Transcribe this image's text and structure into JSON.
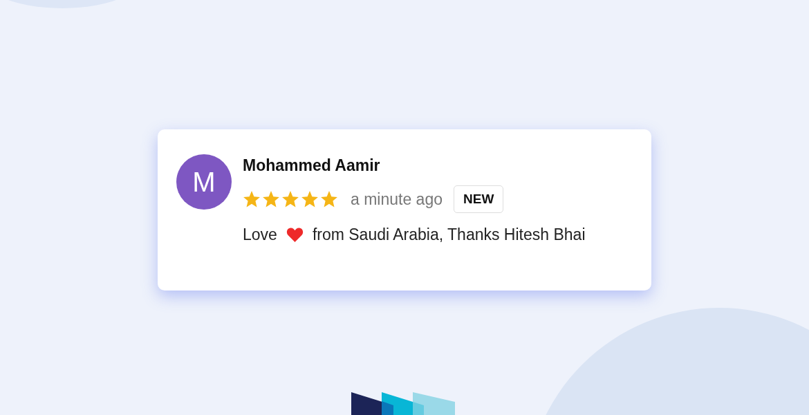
{
  "review": {
    "avatar_letter": "M",
    "name": "Mohammed Aamir",
    "stars": 5,
    "time": "a minute ago",
    "badge": "NEW",
    "message_before": "Love",
    "message_after": "from Saudi Arabia, Thanks Hitesh Bhai"
  }
}
